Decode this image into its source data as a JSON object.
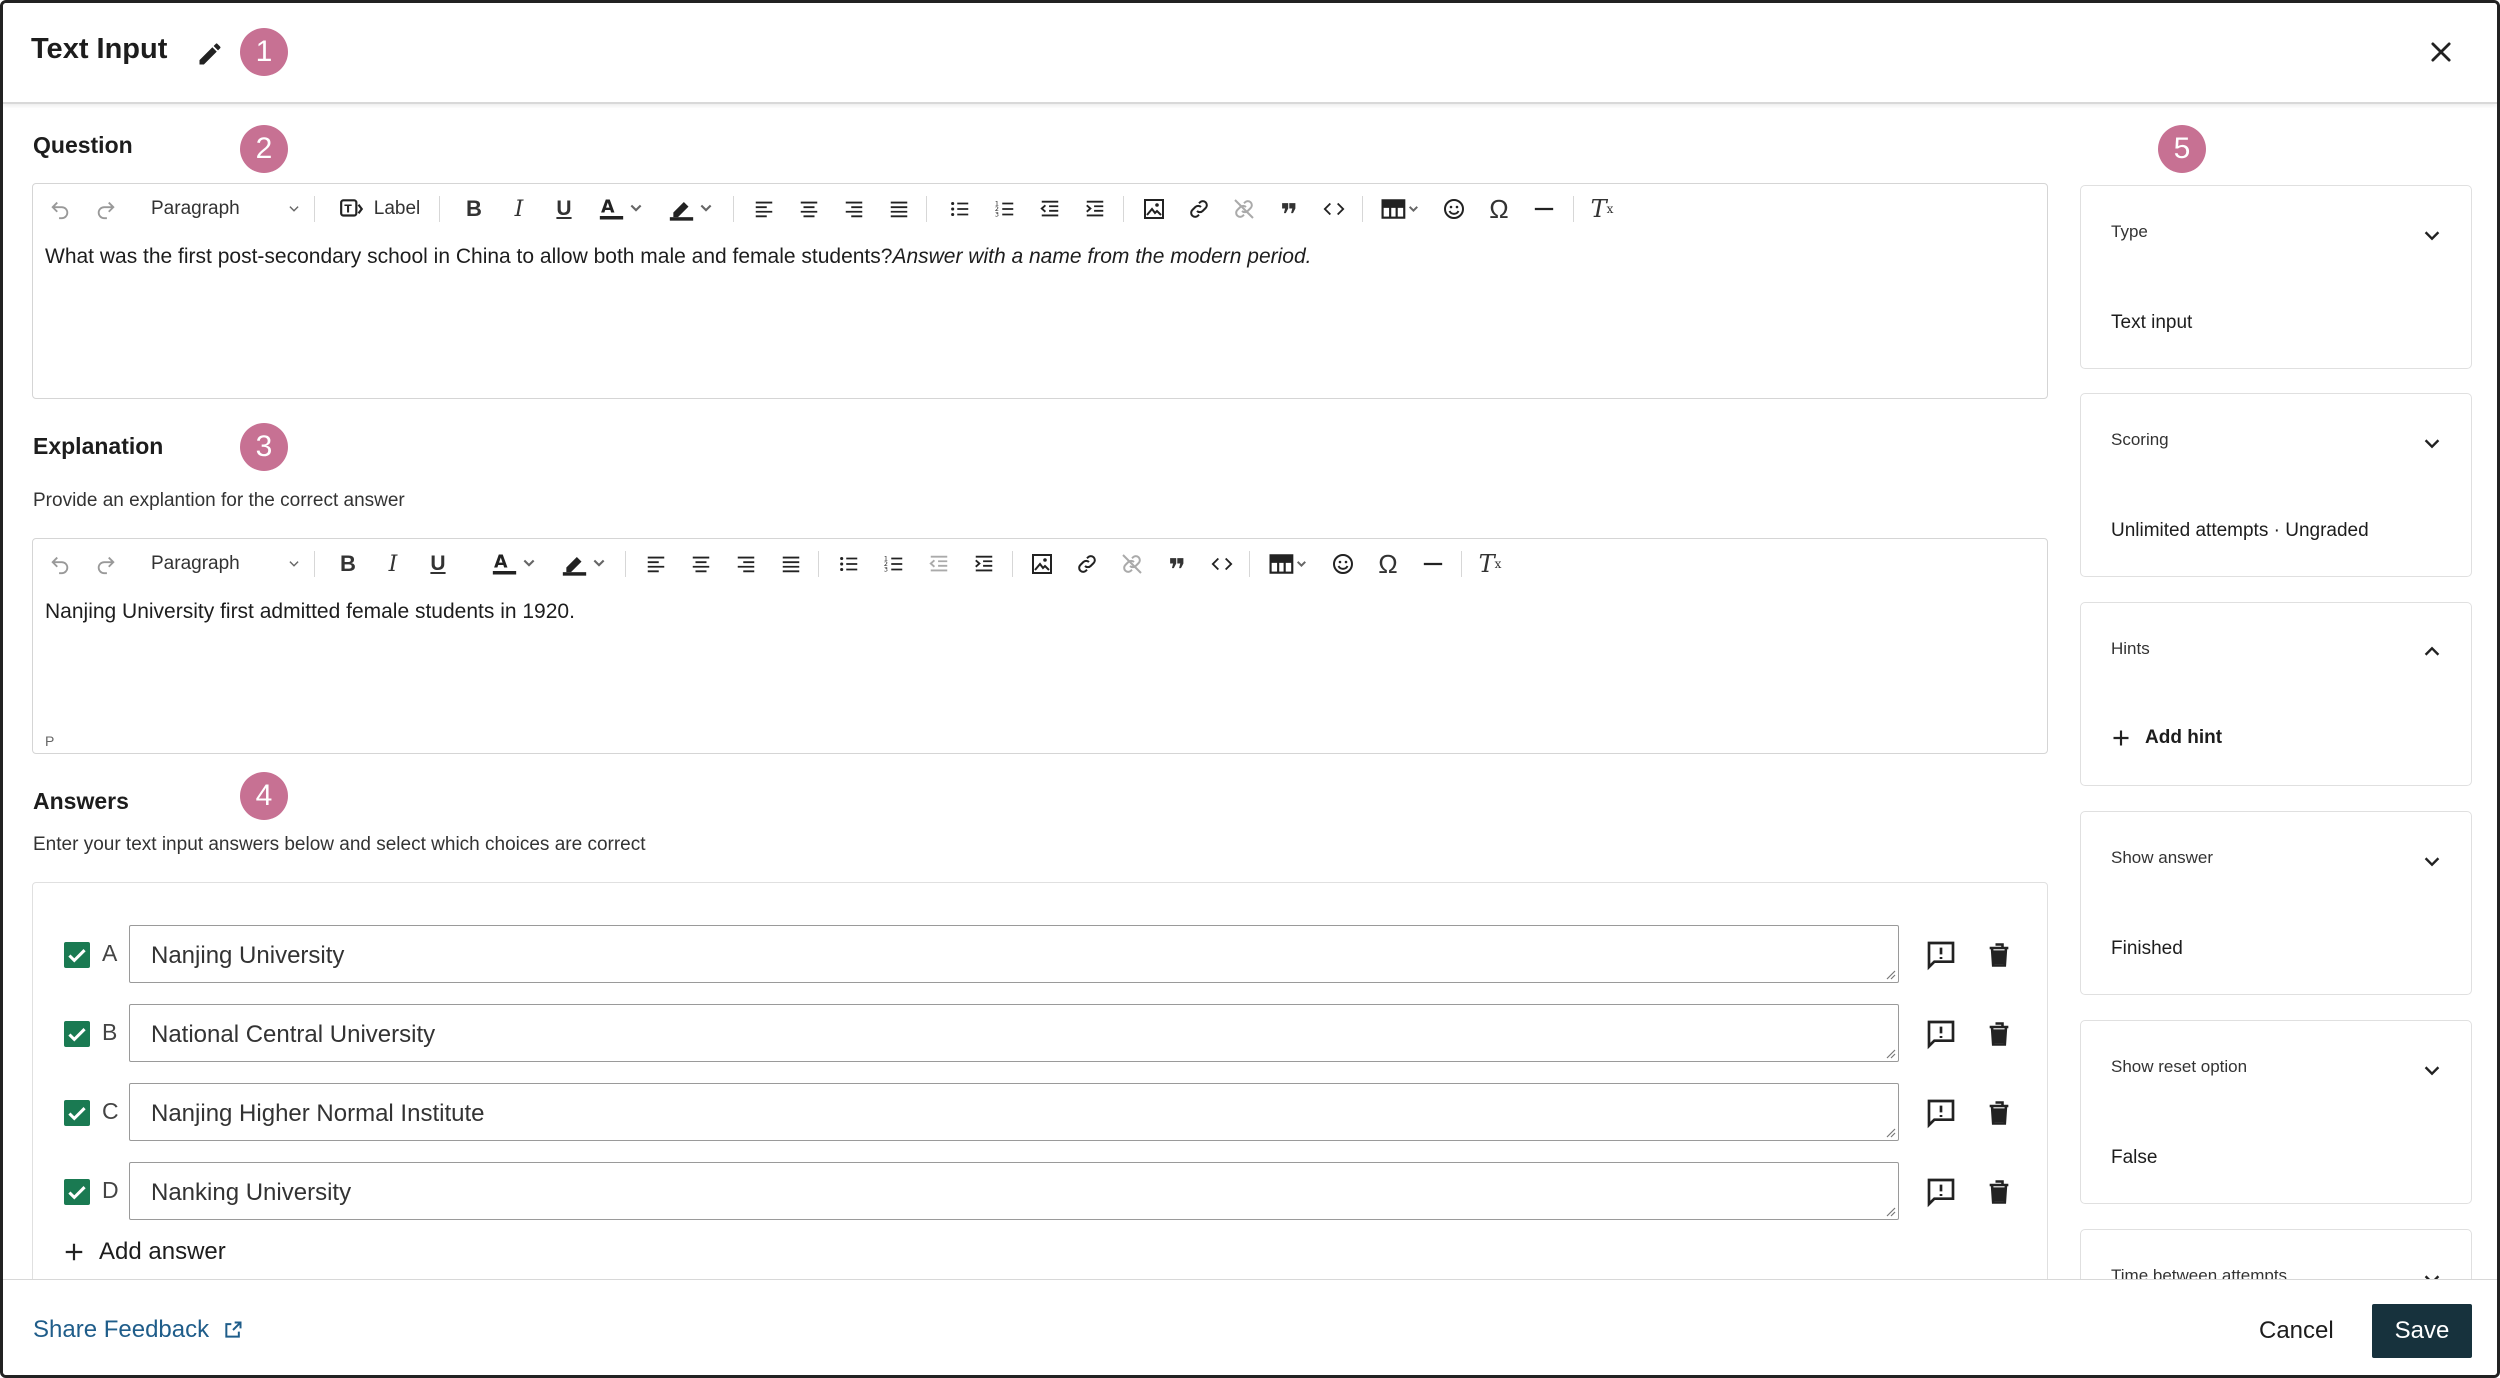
{
  "header": {
    "title": "Text Input"
  },
  "badges": [
    "1",
    "2",
    "3",
    "4",
    "5"
  ],
  "question": {
    "title": "Question",
    "format": "Paragraph",
    "label_button": "Label",
    "text": "What was the first post-secondary school in China to allow both male and female students?",
    "text_italic": "Answer with a name from the modern period."
  },
  "explanation": {
    "title": "Explanation",
    "description": "Provide an explantion for the correct answer",
    "format": "Paragraph",
    "text": "Nanjing University first admitted female students in 1920.",
    "status": "P"
  },
  "answers": {
    "title": "Answers",
    "description": "Enter your text input answers below and select which choices are correct",
    "items": [
      {
        "letter": "A",
        "value": "Nanjing University",
        "correct": true
      },
      {
        "letter": "B",
        "value": "National Central University",
        "correct": true
      },
      {
        "letter": "C",
        "value": "Nanjing Higher Normal Institute",
        "correct": true
      },
      {
        "letter": "D",
        "value": "Nanking University",
        "correct": true
      }
    ],
    "add_label": "Add answer"
  },
  "settings": [
    {
      "label": "Type",
      "value": "Text input",
      "expanded": false
    },
    {
      "label": "Scoring",
      "value": "Unlimited attempts · Ungraded",
      "expanded": false
    },
    {
      "label": "Hints",
      "value": "Add hint",
      "expanded": true
    },
    {
      "label": "Show answer",
      "value": "Finished",
      "expanded": false
    },
    {
      "label": "Show reset option",
      "value": "False",
      "expanded": false
    },
    {
      "label": "Time between attempts",
      "value": "",
      "expanded": false
    }
  ],
  "footer": {
    "share": "Share Feedback",
    "cancel": "Cancel",
    "save": "Save"
  },
  "colors": {
    "badge": "#c77193",
    "checkbox": "#1a7a52",
    "save_bg": "#17323d",
    "link": "#1f5d8a"
  }
}
